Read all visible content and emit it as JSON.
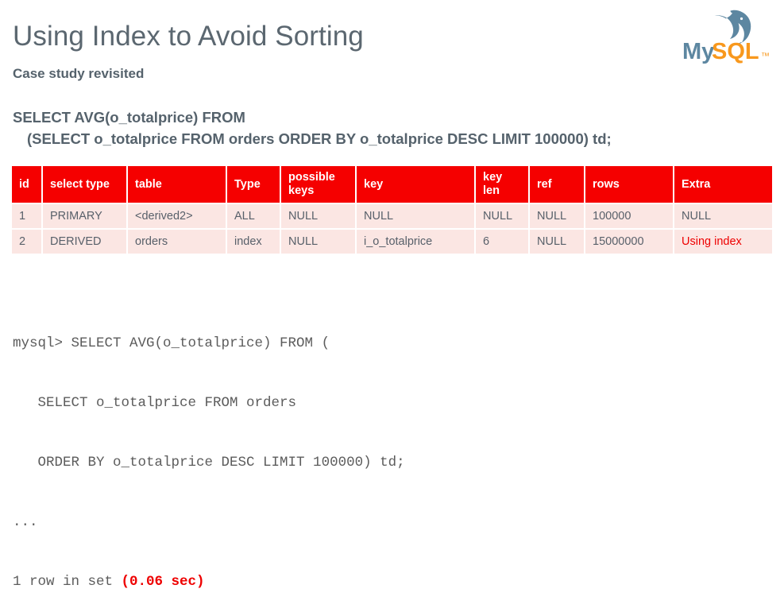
{
  "slide": {
    "title": "Using Index to Avoid Sorting",
    "subtitle": "Case study revisited",
    "logo_alt": "MySQL",
    "logo_wordmark_my": "My",
    "logo_wordmark_sql": "SQL",
    "logo_trademark": "™"
  },
  "sql_statement": {
    "line1": "SELECT AVG(o_totalprice) FROM",
    "line2": "(SELECT o_totalprice FROM orders ORDER BY o_totalprice DESC LIMIT 100000) td;"
  },
  "explain_table": {
    "headers": [
      "id",
      "select type",
      "table",
      "Type",
      "possible keys",
      "key",
      "key len",
      "ref",
      "rows",
      "Extra"
    ],
    "rows": [
      {
        "id": "1",
        "select_type": "PRIMARY",
        "table": "<derived2>",
        "type": "ALL",
        "possible_keys": "NULL",
        "key": "NULL",
        "key_len": "NULL",
        "ref": "NULL",
        "rows": "100000",
        "extra": "NULL",
        "extra_highlight": false
      },
      {
        "id": "2",
        "select_type": "DERIVED",
        "table": "orders",
        "type": "index",
        "possible_keys": "NULL",
        "key": "i_o_totalprice",
        "key_len": "6",
        "ref": "NULL",
        "rows": "15000000",
        "extra": "Using index",
        "extra_highlight": true
      }
    ]
  },
  "console": {
    "line1": "mysql> SELECT AVG(o_totalprice) FROM (",
    "line2": "   SELECT o_totalprice FROM orders",
    "line3": "   ORDER BY o_totalprice DESC LIMIT 100000) td;",
    "line4": "...",
    "line5_prefix": "1 row in set ",
    "line5_timing": "(0.06 sec)"
  },
  "colors": {
    "title": "#5b6770",
    "table_header_bg": "#f50000",
    "table_row_bg": "#fbe6e3",
    "highlight_red": "#ee0000",
    "logo_blue": "#5d87a1",
    "logo_orange": "#f8981d"
  }
}
